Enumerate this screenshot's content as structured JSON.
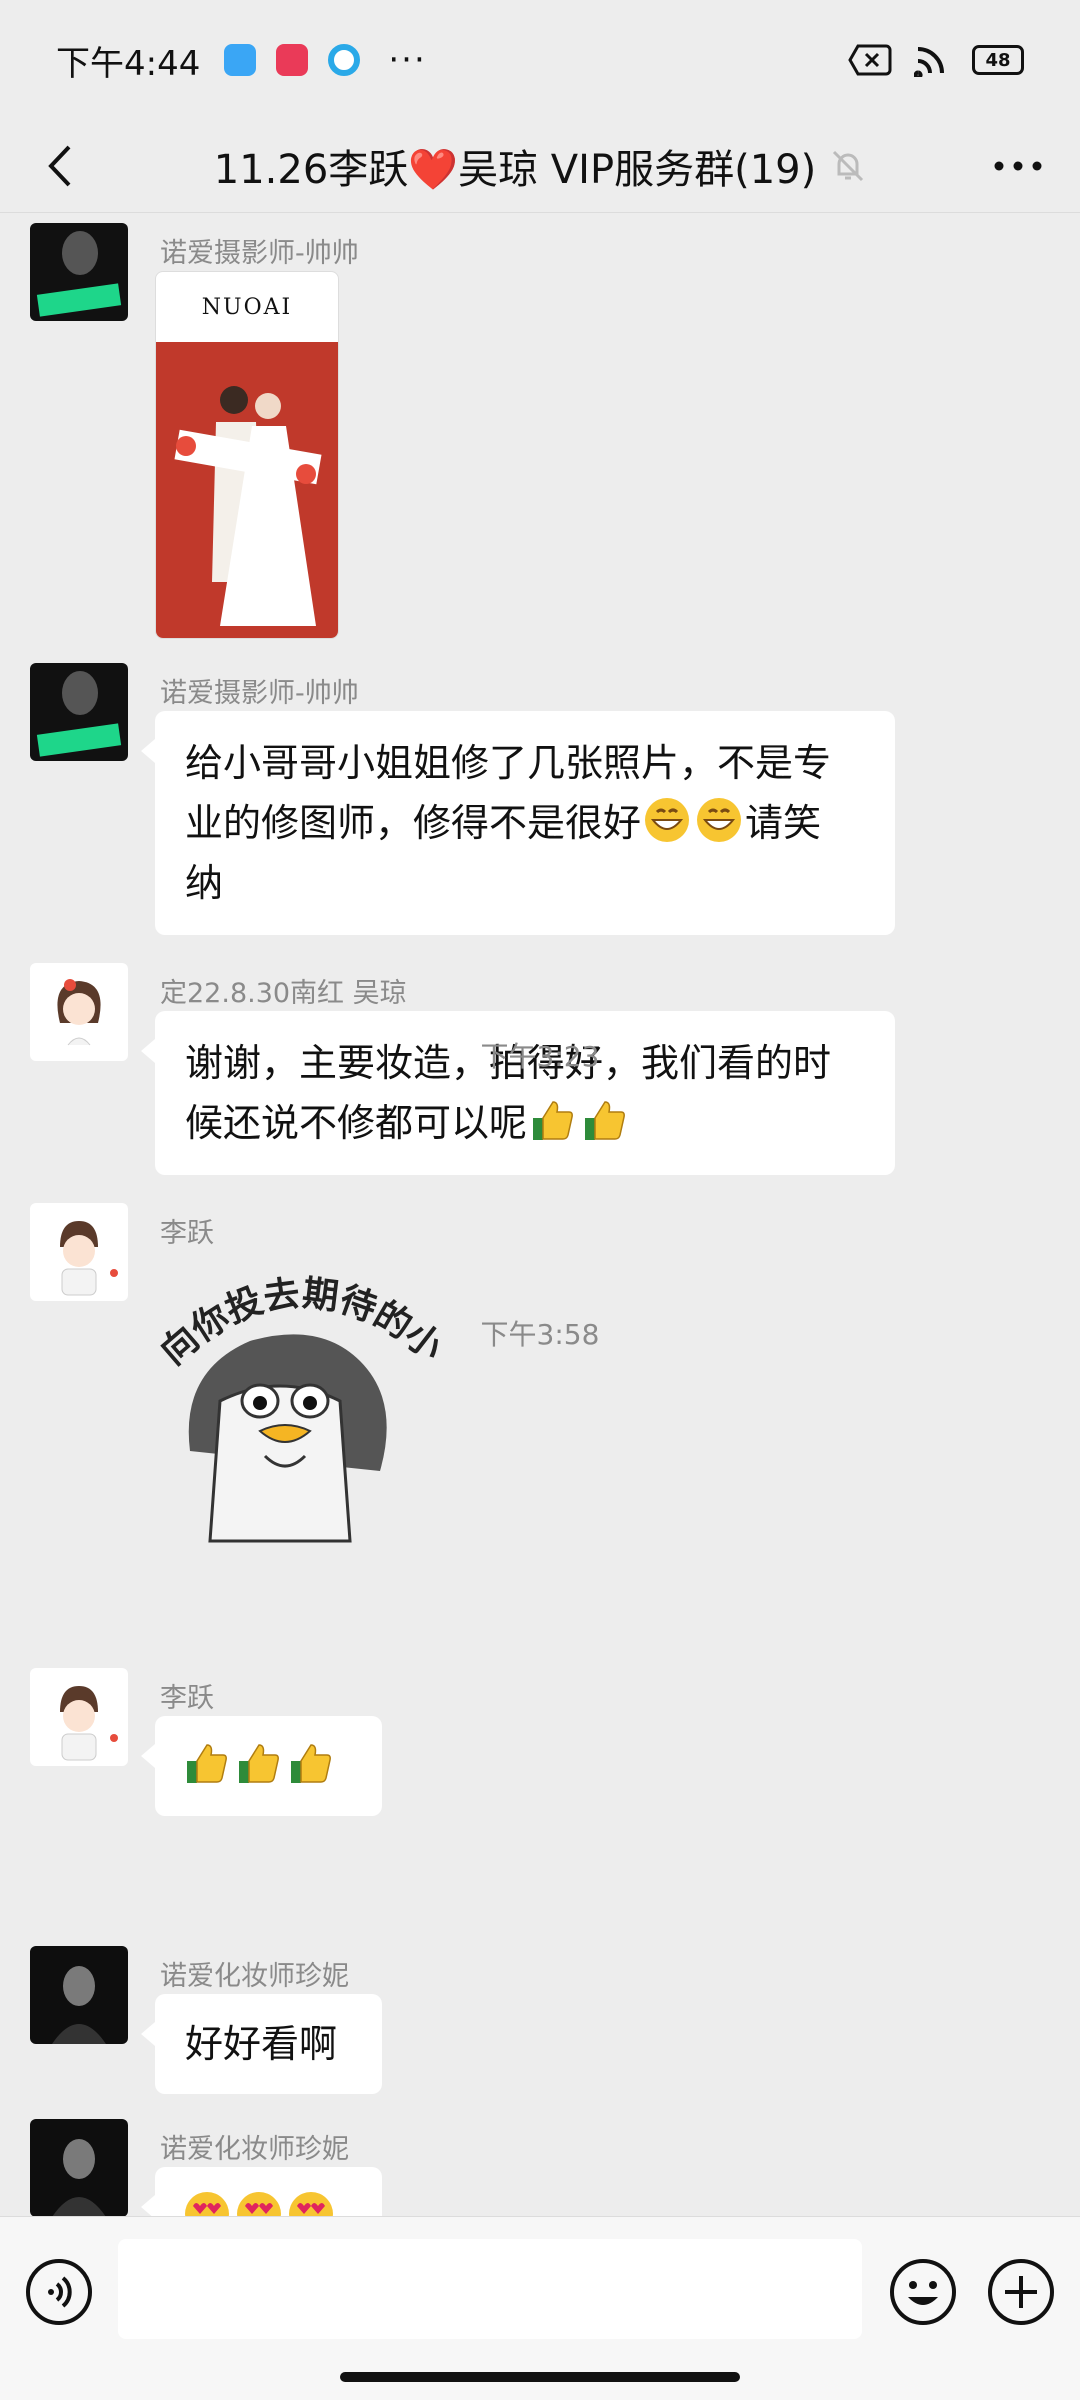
{
  "status_bar": {
    "time": "下午4:44",
    "dots": "···",
    "battery": "48"
  },
  "header": {
    "title": "11.26李跃❤️吴琼  VIP服务群(19)",
    "back_icon": "chevron-left-icon",
    "more_icon": "more-horizontal-icon",
    "mute_icon": "bell-off-icon"
  },
  "messages": [
    {
      "sender": "诺爱摄影师-帅帅",
      "type": "image",
      "image_caption": "NUOAI"
    },
    {
      "sender": "诺爱摄影师-帅帅",
      "type": "text",
      "line1": "给小哥哥小姐姐修了几张照片，不是专",
      "line2": "业的修图师，修得不是很好",
      "line2_tail": "请笑",
      "line3": "纳"
    },
    {
      "sender": "定22.8.30南红 吴琼",
      "type": "text",
      "line1": "谢谢，主要妆造，拍得好，我们看的时",
      "line2": "候还说不修都可以呢"
    },
    {
      "sender": "李跃",
      "type": "sticker",
      "sticker_text": "向你投去期待的小目光"
    },
    {
      "sender": "李跃",
      "type": "emoji",
      "emoji": "thumbs-up x3"
    },
    {
      "sender": "诺爱化妆师珍妮",
      "type": "text",
      "line1": "好好看啊"
    },
    {
      "sender": "诺爱化妆师珍妮",
      "type": "emoji",
      "emoji": "heart-eyes x3"
    }
  ],
  "timestamps": [
    "下午3:23",
    "下午3:58"
  ],
  "input": {
    "placeholder": ""
  },
  "colors": {
    "background": "#ededed",
    "bubble": "#ffffff",
    "meta_text": "#8a8a8a",
    "photo_bg": "#c0392b"
  }
}
